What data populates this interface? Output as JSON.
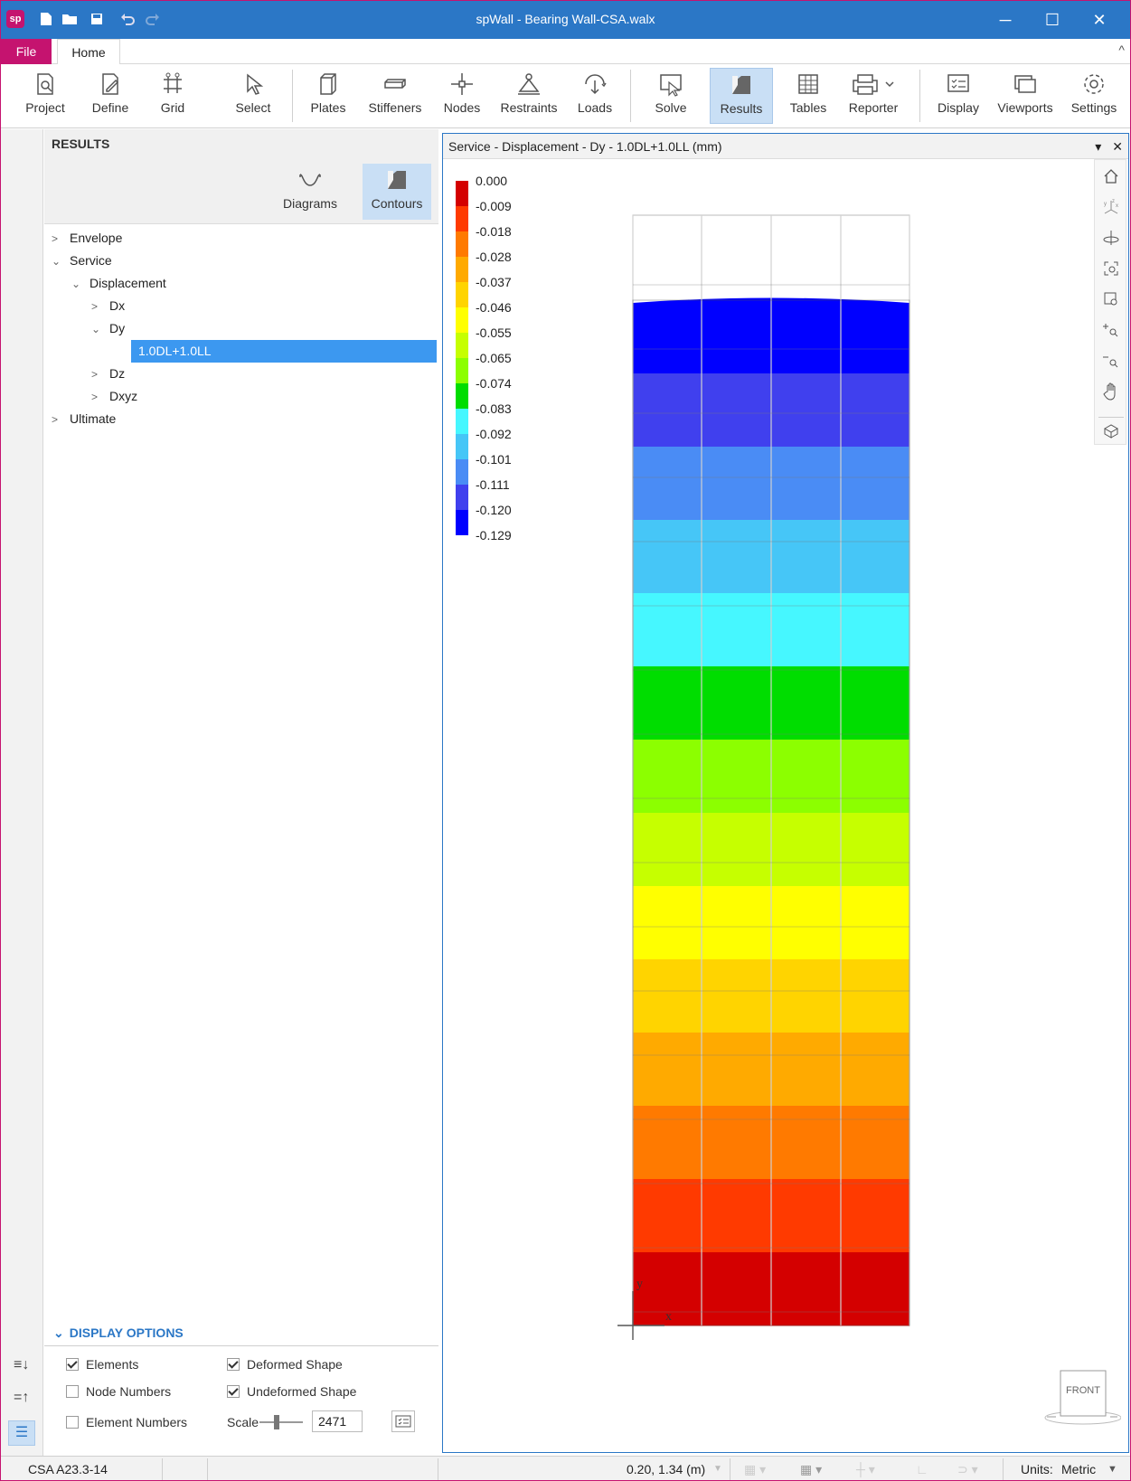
{
  "window": {
    "title": "spWall - Bearing Wall-CSA.walx",
    "logo": "sp",
    "minimize": "─",
    "maximize": "☐",
    "close": "✕"
  },
  "quick_access": [
    "app-logo",
    "new-file-icon",
    "open-folder-icon",
    "save-icon",
    "undo-icon",
    "redo-icon"
  ],
  "tabs": {
    "file": "File",
    "home": "Home",
    "collapse": "^"
  },
  "ribbon": [
    {
      "label": "Project",
      "icon": "project-icon"
    },
    {
      "label": "Define",
      "icon": "define-icon"
    },
    {
      "label": "Grid",
      "icon": "grid-icon"
    },
    {
      "label": "Select",
      "icon": "select-icon"
    },
    {
      "label": "Plates",
      "icon": "plates-icon"
    },
    {
      "label": "Stiffeners",
      "icon": "stiffeners-icon"
    },
    {
      "label": "Nodes",
      "icon": "nodes-icon"
    },
    {
      "label": "Restraints",
      "icon": "restraints-icon"
    },
    {
      "label": "Loads",
      "icon": "loads-icon"
    },
    {
      "label": "Solve",
      "icon": "solve-icon"
    },
    {
      "label": "Results",
      "icon": "results-icon",
      "active": true
    },
    {
      "label": "Tables",
      "icon": "tables-icon"
    },
    {
      "label": "Reporter",
      "icon": "reporter-icon"
    },
    {
      "label": "Display",
      "icon": "display-icon"
    },
    {
      "label": "Viewports",
      "icon": "viewports-icon"
    },
    {
      "label": "Settings",
      "icon": "settings-icon"
    }
  ],
  "results_panel": {
    "header": "RESULTS",
    "toolbar": {
      "diagrams": "Diagrams",
      "contours": "Contours"
    },
    "tree": {
      "envelope": "Envelope",
      "service": "Service",
      "displacement": "Displacement",
      "dx": "Dx",
      "dy": "Dy",
      "selected": "1.0DL+1.0LL",
      "dz": "Dz",
      "dxyz": "Dxyz",
      "ultimate": "Ultimate"
    }
  },
  "display_options": {
    "header": "DISPLAY OPTIONS",
    "elements": {
      "label": "Elements",
      "checked": true
    },
    "node_numbers": {
      "label": "Node Numbers",
      "checked": false
    },
    "element_numbers": {
      "label": "Element Numbers",
      "checked": false
    },
    "deformed_shape": {
      "label": "Deformed Shape",
      "checked": true
    },
    "undeformed_shape": {
      "label": "Undeformed Shape",
      "checked": true
    },
    "scale_label": "Scale",
    "scale_value": "2471"
  },
  "viewport": {
    "title": "Service - Displacement - Dy - 1.0DL+1.0LL (mm)",
    "menu": "▾",
    "close": "✕",
    "axis_x": "x",
    "axis_y": "y",
    "cube_label": "FRONT"
  },
  "legend": {
    "values": [
      "0.000",
      "-0.009",
      "-0.018",
      "-0.028",
      "-0.037",
      "-0.046",
      "-0.055",
      "-0.065",
      "-0.074",
      "-0.083",
      "-0.092",
      "-0.101",
      "-0.111",
      "-0.120",
      "-0.129"
    ],
    "colors": [
      "#d40000",
      "#ff3a00",
      "#ff7a00",
      "#ffaa00",
      "#ffd400",
      "#ffff00",
      "#c6ff00",
      "#8cff00",
      "#00dd00",
      "#46f7ff",
      "#46c6f7",
      "#4a8cf5",
      "#4040ee",
      "#0000ff"
    ]
  },
  "status_bar": {
    "code": "CSA A23.3-14",
    "coords": "0.20, 1.34 (m)",
    "units_label": "Units:",
    "units_value": "Metric"
  }
}
